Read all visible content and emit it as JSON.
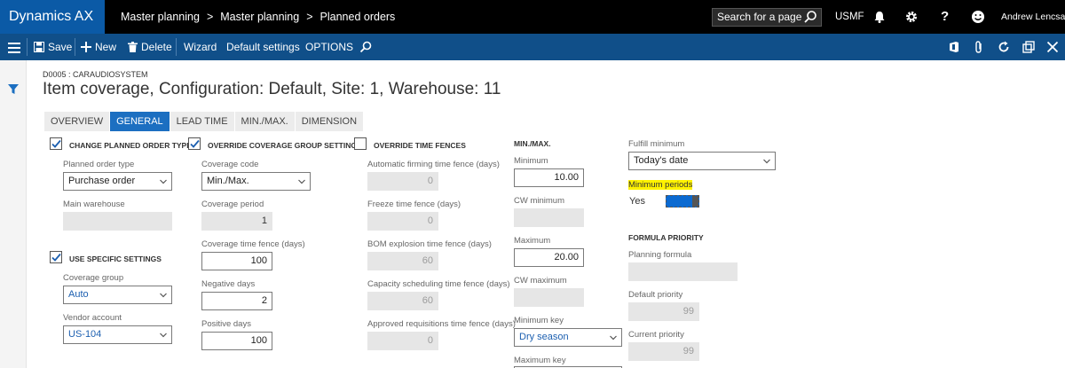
{
  "app": {
    "name": "Dynamics AX"
  },
  "breadcrumbs": [
    "Master planning",
    "Master planning",
    "Planned orders"
  ],
  "search": {
    "placeholder": "Search for a page"
  },
  "company": "USMF",
  "user": "Andrew Lencsak",
  "actions": {
    "save": "Save",
    "new": "New",
    "delete": "Delete",
    "wizard": "Wizard",
    "default_settings": "Default settings",
    "options": "OPTIONS"
  },
  "header": {
    "item": "D0005 : CARAUDIOSYSTEM",
    "title": "Item coverage, Configuration: Default, Site: 1, Warehouse: 11"
  },
  "tabs": [
    "OVERVIEW",
    "GENERAL",
    "LEAD TIME",
    "MIN./MAX.",
    "DIMENSION"
  ],
  "active_tab": "GENERAL",
  "form": {
    "change_planned_order_type": {
      "label": "CHANGE PLANNED ORDER TYPE",
      "checked": true
    },
    "planned_order_type": {
      "label": "Planned order type",
      "value": "Purchase order"
    },
    "main_warehouse": {
      "label": "Main warehouse",
      "value": ""
    },
    "use_specific_settings": {
      "label": "USE SPECIFIC SETTINGS",
      "checked": true
    },
    "coverage_group": {
      "label": "Coverage group",
      "value": "Auto"
    },
    "vendor_account": {
      "label": "Vendor account",
      "value": "US-104"
    },
    "override_coverage_group_settings": {
      "label": "OVERRIDE COVERAGE GROUP SETTINGS",
      "checked": true
    },
    "coverage_code": {
      "label": "Coverage code",
      "value": "Min./Max."
    },
    "coverage_period": {
      "label": "Coverage period",
      "value": "1"
    },
    "coverage_time_fence": {
      "label": "Coverage time fence (days)",
      "value": "100"
    },
    "negative_days": {
      "label": "Negative days",
      "value": "2"
    },
    "positive_days": {
      "label": "Positive days",
      "value": "100"
    },
    "override_time_fences": {
      "label": "OVERRIDE TIME FENCES",
      "checked": false
    },
    "automatic_firming": {
      "label": "Automatic firming time fence (days)",
      "value": "0"
    },
    "freeze_time_fence": {
      "label": "Freeze time fence (days)",
      "value": "0"
    },
    "bom_explosion": {
      "label": "BOM explosion time fence (days)",
      "value": "60"
    },
    "capacity_scheduling": {
      "label": "Capacity scheduling time fence (days)",
      "value": "60"
    },
    "approved_requisitions": {
      "label": "Approved requisitions time fence (days)",
      "value": "0"
    },
    "minmax_section": "MIN./MAX.",
    "minimum": {
      "label": "Minimum",
      "value": "10.00"
    },
    "cw_minimum": {
      "label": "CW minimum",
      "value": ""
    },
    "maximum": {
      "label": "Maximum",
      "value": "20.00"
    },
    "cw_maximum": {
      "label": "CW maximum",
      "value": ""
    },
    "minimum_key": {
      "label": "Minimum key",
      "value": "Dry season"
    },
    "maximum_key": {
      "label": "Maximum key"
    },
    "fulfill_minimum": {
      "label": "Fulfill minimum",
      "value": "Today's date"
    },
    "minimum_periods": {
      "label": "Minimum periods",
      "value": "Yes",
      "on": true
    },
    "formula_priority_section": "FORMULA PRIORITY",
    "planning_formula": {
      "label": "Planning formula",
      "value": ""
    },
    "default_priority": {
      "label": "Default priority",
      "value": "99"
    },
    "current_priority": {
      "label": "Current priority",
      "value": "99"
    }
  },
  "colors": {
    "brand": "#0b5aa6",
    "actionbar": "#104f89",
    "active_tab": "#1c6fc1",
    "highlight": "#fff200"
  }
}
